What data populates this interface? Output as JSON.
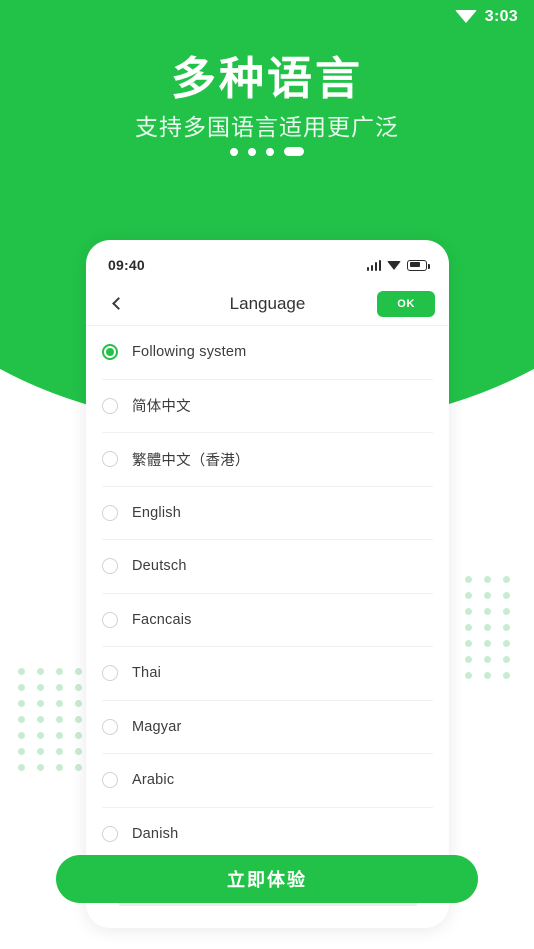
{
  "theme": {
    "brand_green": "#22c248",
    "dot_grid_green": "#c8ebd2",
    "subtitle_green": "#eafaef"
  },
  "system_status_bar": {
    "wifi_icon": "wifi-icon",
    "time": "3:03"
  },
  "hero": {
    "title": "多种语言",
    "subtitle": "支持多国语言适用更广泛",
    "pagination": {
      "total": 4,
      "active_index": 3
    }
  },
  "phone": {
    "status_bar": {
      "time": "09:40",
      "signal_icon": "signal-bars-icon",
      "wifi_icon": "wifi-icon",
      "battery_icon": "battery-icon"
    },
    "nav": {
      "back_icon": "chevron-left-icon",
      "title": "Language",
      "ok_label": "OK"
    },
    "languages": [
      {
        "label": "Following system",
        "selected": true
      },
      {
        "label": "简体中文",
        "selected": false
      },
      {
        "label": "繁體中文（香港）",
        "selected": false
      },
      {
        "label": "English",
        "selected": false
      },
      {
        "label": "Deutsch",
        "selected": false
      },
      {
        "label": "Facncais",
        "selected": false
      },
      {
        "label": "Thai",
        "selected": false
      },
      {
        "label": "Magyar",
        "selected": false
      },
      {
        "label": "Arabic",
        "selected": false
      },
      {
        "label": "Danish",
        "selected": false
      }
    ]
  },
  "cta": {
    "label": "立即体验"
  },
  "decor": {
    "dot_grid_left": {
      "columns": 4,
      "rows": 7
    },
    "dot_grid_right": {
      "columns": 3,
      "rows": 7
    }
  }
}
